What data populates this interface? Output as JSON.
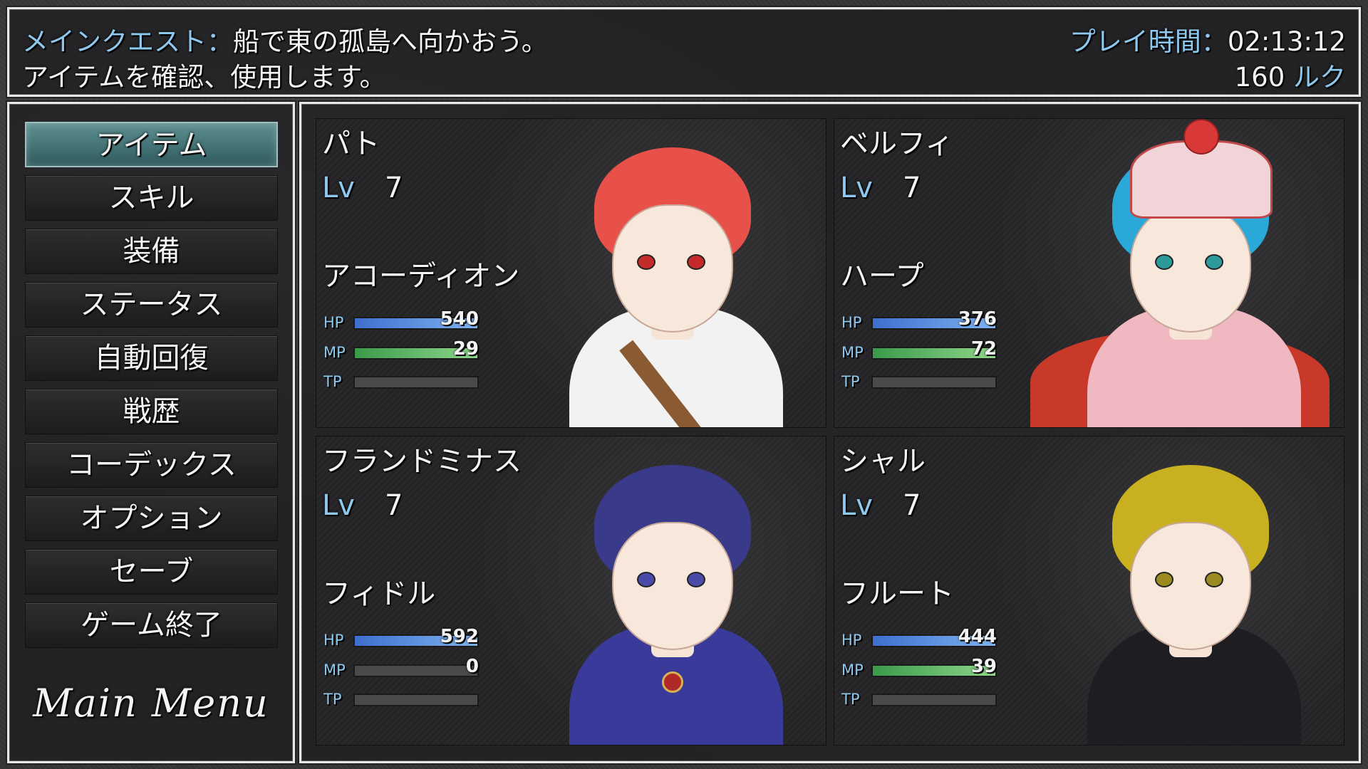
{
  "header": {
    "quest_label": "メインクエスト：",
    "quest_text": "船で東の孤島へ向かおう。",
    "help_text": "アイテムを確認、使用します。",
    "playtime_label": "プレイ時間：",
    "playtime_value": "02:13:12",
    "gold_value": "160",
    "gold_unit": "ルク"
  },
  "menu": {
    "items": [
      {
        "label": "アイテム",
        "selected": true
      },
      {
        "label": "スキル"
      },
      {
        "label": "装備"
      },
      {
        "label": "ステータス"
      },
      {
        "label": "自動回復"
      },
      {
        "label": "戦歴"
      },
      {
        "label": "コーデックス"
      },
      {
        "label": "オプション"
      },
      {
        "label": "セーブ"
      },
      {
        "label": "ゲーム終了"
      }
    ],
    "logo_text": "Main Menu"
  },
  "labels": {
    "lv": "Lv",
    "hp": "HP",
    "mp": "MP",
    "tp": "TP"
  },
  "actors": [
    {
      "name": "パト",
      "level": "7",
      "class": "アコーディオン",
      "hp": "540",
      "mp": "29",
      "tp": "",
      "hp_rate": 1.0,
      "mp_rate": 1.0,
      "tp_rate": 0.0,
      "hair_color": "#e8504a",
      "outfit_color": "#f2f2f2",
      "eye_color": "#c42a2a"
    },
    {
      "name": "ベルフィ",
      "level": "7",
      "class": "ハープ",
      "hp": "376",
      "mp": "72",
      "tp": "",
      "hp_rate": 1.0,
      "mp_rate": 1.0,
      "tp_rate": 0.0,
      "hair_color": "#2aa8d8",
      "outfit_color": "#f0b8c0",
      "eye_color": "#2a9a9a"
    },
    {
      "name": "フランドミナス",
      "level": "7",
      "class": "フィドル",
      "hp": "592",
      "mp": "0",
      "tp": "",
      "hp_rate": 1.0,
      "mp_rate": 0.0,
      "tp_rate": 0.0,
      "hair_color": "#3a3a8a",
      "outfit_color": "#3a3a9a",
      "eye_color": "#4a4aa8"
    },
    {
      "name": "シャル",
      "level": "7",
      "class": "フルート",
      "hp": "444",
      "mp": "39",
      "tp": "",
      "hp_rate": 1.0,
      "mp_rate": 1.0,
      "tp_rate": 0.0,
      "hair_color": "#c8b020",
      "outfit_color": "#1e1e22",
      "eye_color": "#9a8a20"
    }
  ],
  "colors": {
    "accent": "#8fc8ee",
    "frame": "#e8e8e8",
    "selected": "#4a7a7e"
  }
}
